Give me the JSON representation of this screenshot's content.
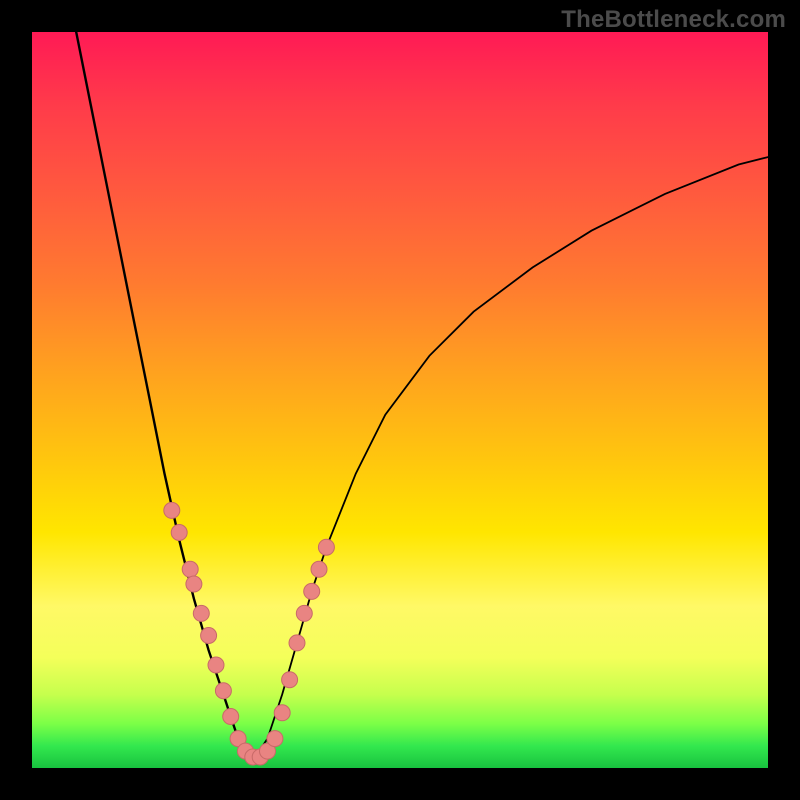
{
  "watermark": "TheBottleneck.com",
  "chart_data": {
    "type": "line",
    "title": "",
    "xlabel": "",
    "ylabel": "",
    "xlim": [
      0,
      100
    ],
    "ylim": [
      0,
      100
    ],
    "grid": false,
    "legend": false,
    "background_gradient": {
      "direction": "vertical",
      "stops": [
        {
          "pos": 0.0,
          "color": "#ff1a55"
        },
        {
          "pos": 0.34,
          "color": "#ff7a30"
        },
        {
          "pos": 0.68,
          "color": "#ffe600"
        },
        {
          "pos": 0.9,
          "color": "#c6ff4d"
        },
        {
          "pos": 1.0,
          "color": "#18c23f"
        }
      ]
    },
    "series": [
      {
        "name": "curve-left",
        "x": [
          6,
          8,
          10,
          12,
          14,
          16,
          18,
          20,
          22,
          24,
          26,
          27,
          28,
          29,
          30
        ],
        "y": [
          100,
          90,
          80,
          70,
          60,
          50,
          40,
          31,
          23,
          16,
          10,
          7,
          4,
          2,
          1
        ]
      },
      {
        "name": "curve-right",
        "x": [
          30,
          32,
          34,
          36,
          38,
          40,
          44,
          48,
          54,
          60,
          68,
          76,
          86,
          96,
          100
        ],
        "y": [
          1,
          4,
          10,
          17,
          24,
          30,
          40,
          48,
          56,
          62,
          68,
          73,
          78,
          82,
          83
        ]
      }
    ],
    "markers": [
      {
        "x": 19.0,
        "y": 35.0
      },
      {
        "x": 20.0,
        "y": 32.0
      },
      {
        "x": 21.5,
        "y": 27.0
      },
      {
        "x": 22.0,
        "y": 25.0
      },
      {
        "x": 23.0,
        "y": 21.0
      },
      {
        "x": 24.0,
        "y": 18.0
      },
      {
        "x": 25.0,
        "y": 14.0
      },
      {
        "x": 26.0,
        "y": 10.5
      },
      {
        "x": 27.0,
        "y": 7.0
      },
      {
        "x": 28.0,
        "y": 4.0
      },
      {
        "x": 29.0,
        "y": 2.3
      },
      {
        "x": 30.0,
        "y": 1.5
      },
      {
        "x": 31.0,
        "y": 1.5
      },
      {
        "x": 32.0,
        "y": 2.3
      },
      {
        "x": 33.0,
        "y": 4.0
      },
      {
        "x": 34.0,
        "y": 7.5
      },
      {
        "x": 35.0,
        "y": 12.0
      },
      {
        "x": 36.0,
        "y": 17.0
      },
      {
        "x": 37.0,
        "y": 21.0
      },
      {
        "x": 38.0,
        "y": 24.0
      },
      {
        "x": 39.0,
        "y": 27.0
      },
      {
        "x": 40.0,
        "y": 30.0
      }
    ],
    "marker_style": {
      "shape": "circle",
      "radius_px": 8,
      "fill": "#e98482",
      "stroke": "#c86a68"
    }
  }
}
